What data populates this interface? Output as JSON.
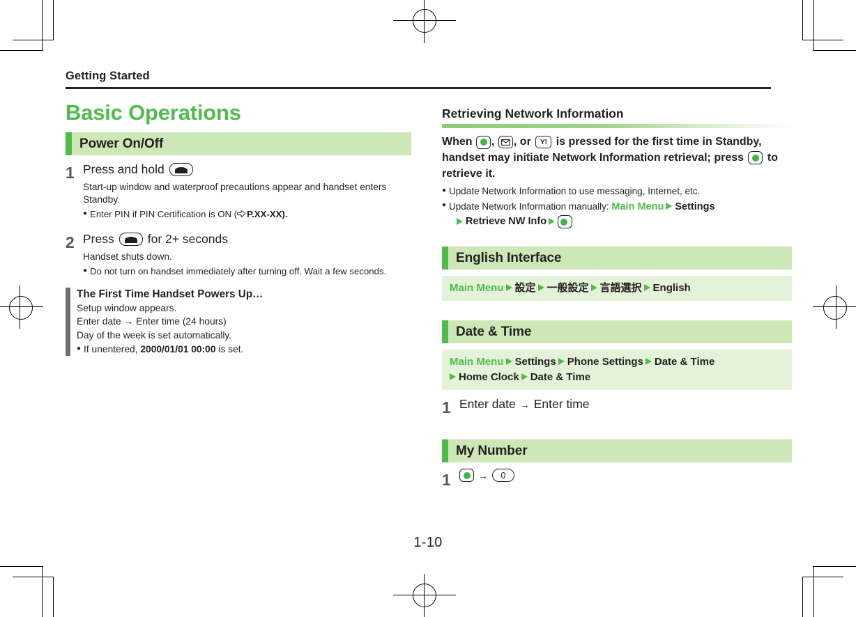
{
  "running_head": {
    "title": "Getting Started"
  },
  "page_number": "1-10",
  "colors": {
    "accent_green": "#4FBB4B",
    "bar_light_green": "#CDE8B6",
    "path_band_green": "#E3F2D8",
    "note_bar_gray": "#6D6E71",
    "text": "#231f20"
  },
  "left_column": {
    "chapter_title": "Basic Operations",
    "section": {
      "label": "Power On/Off"
    },
    "steps": [
      {
        "num": "1",
        "title_pre": "Press and hold",
        "key": "end-call-key",
        "desc": "Start-up window and waterproof precautions appear and handset enters Standby.",
        "bullets": [
          {
            "dot": "●",
            "text_pre": "Enter PIN if PIN Certification is ON (",
            "ref_icon": "reference-pointer-icon",
            "ref": "P.XX-XX",
            "text_post": ")."
          }
        ]
      },
      {
        "num": "2",
        "title_pre": "Press",
        "key": "end-call-key",
        "title_post": "for 2+ seconds",
        "desc": "Handset shuts down.",
        "bullets": [
          {
            "dot": "●",
            "text": "Do not turn on handset immediately after turning off. Wait a few seconds."
          }
        ]
      }
    ],
    "note_box": {
      "title": "The First Time Handset Powers Up…",
      "lines": [
        "Setup window appears.",
        "Enter date → Enter time (24 hours)",
        "Day of the week is set automatically."
      ],
      "bullet": {
        "dot": "●",
        "pre": "If unentered, ",
        "bold": "2000/01/01 00:00",
        "post": " is set."
      }
    }
  },
  "right_column": {
    "network_info": {
      "heading": "Retrieving Network Information",
      "lead": {
        "t1": "When",
        "key1": "center-key",
        "t2": ",",
        "key2": "mail-key",
        "t3": ", or",
        "key3": "yahoo-key",
        "t4": "is pressed for the first time in Standby, handset may initiate Network Information retrieval; press",
        "key4": "center-key",
        "t5": "to retrieve it."
      },
      "bullets": [
        {
          "dot": "●",
          "text": "Update Network Information to use messaging, Internet, etc."
        },
        {
          "dot": "●",
          "pre": "Update Network Information manually: ",
          "main_menu": "Main Menu",
          "crumbs": [
            "Settings",
            "Retrieve NW Info"
          ],
          "end_key": "center-key"
        }
      ]
    },
    "english_interface": {
      "section_label": "English Interface",
      "path": {
        "main_menu": "Main Menu",
        "crumbs": [
          "設定",
          "一般設定",
          "言語選択",
          "English"
        ]
      }
    },
    "date_time": {
      "section_label": "Date & Time",
      "path": {
        "main_menu": "Main Menu",
        "crumbs": [
          "Settings",
          "Phone Settings",
          "Date & Time",
          "Home Clock",
          "Date & Time"
        ]
      },
      "step": {
        "num": "1",
        "text_pre": "Enter date",
        "arrow": "→",
        "text_post": "Enter time"
      }
    },
    "my_number": {
      "section_label": "My Number",
      "step": {
        "num": "1",
        "key1": "center-key",
        "arrow": "→",
        "key2": "zero-key",
        "key2_label": "0"
      }
    }
  }
}
